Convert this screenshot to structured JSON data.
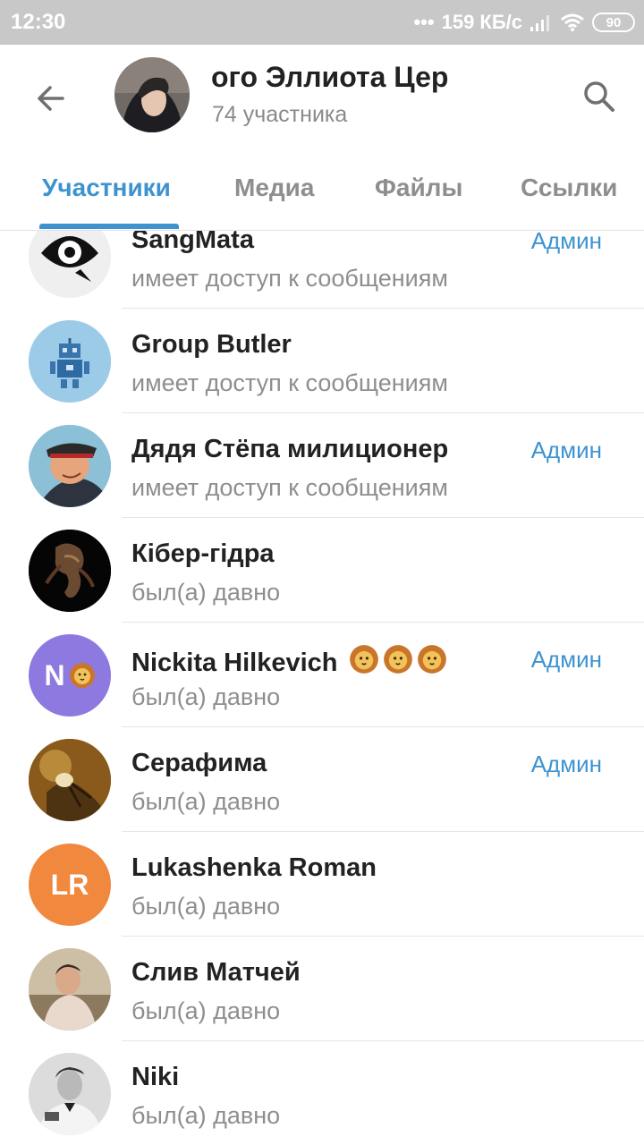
{
  "status_bar": {
    "time": "12:30",
    "network_speed": "159 КБ/с",
    "battery": "90"
  },
  "header": {
    "back_icon": "arrow-left-icon",
    "title": "ого Эллиота   Цер",
    "subtitle": "74 участника",
    "search_icon": "search-icon"
  },
  "tabs": [
    {
      "label": "Участники",
      "active": true
    },
    {
      "label": "Медиа",
      "active": false
    },
    {
      "label": "Файлы",
      "active": false
    },
    {
      "label": "Ссылки",
      "active": false
    }
  ],
  "members": [
    {
      "name": "SangMata",
      "status": "имеет доступ к сообщениям",
      "role": "Админ",
      "avatar": "eye-bubble"
    },
    {
      "name": "Group Butler",
      "status": "имеет доступ к сообщениям",
      "role": "",
      "avatar": "robot"
    },
    {
      "name": "Дядя Стёпа милиционер",
      "status": "имеет доступ к сообщениям",
      "role": "Админ",
      "avatar": "police-cartoon"
    },
    {
      "name": "Кібер-гідра",
      "status": "был(а) давно",
      "role": "",
      "avatar": "hydra"
    },
    {
      "name": "Nickita Hilkevich",
      "status": "был(а) давно",
      "role": "Админ",
      "avatar": "initials",
      "initials": "N",
      "avatar_color": "#8e79e0"
    },
    {
      "name": "Серафима",
      "status": "был(а) давно",
      "role": "Админ",
      "avatar": "painting"
    },
    {
      "name": "Lukashenka Roman",
      "status": "был(а) давно",
      "role": "",
      "avatar": "initials",
      "initials": "LR",
      "avatar_color": "#f0883e"
    },
    {
      "name": "Слив Матчей",
      "status": "был(а) давно",
      "role": "",
      "avatar": "photo"
    },
    {
      "name": "Niki",
      "status": "был(а) давно",
      "role": "",
      "avatar": "bw-photo"
    }
  ],
  "colors": {
    "accent": "#3d93cf",
    "status_bar": "#c8c8c8",
    "muted_text": "#8e8e8e"
  }
}
